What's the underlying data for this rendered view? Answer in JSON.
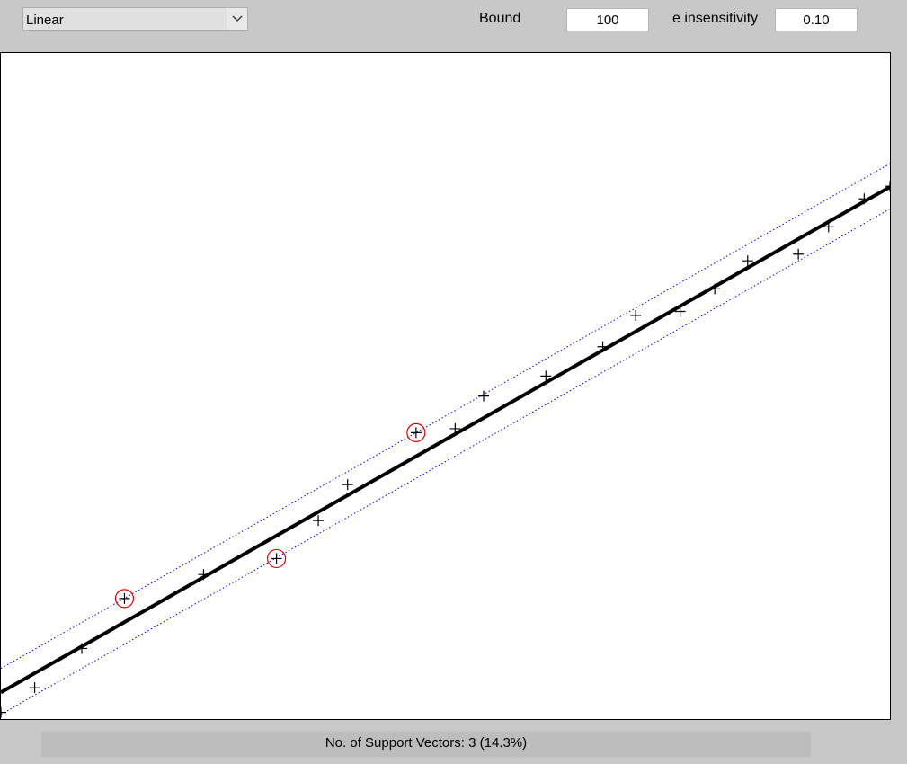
{
  "kernel": {
    "selected": "Linear"
  },
  "params": {
    "bound_label": "Bound",
    "bound_value": "100",
    "epsilon_label": "e insensitivity",
    "epsilon_value": "0.10"
  },
  "status": {
    "text": "No. of Support Vectors: 3 (14.3%)"
  },
  "colors": {
    "background": "#c8c8c8",
    "regression_line": "#000000",
    "tube_line": "#0000ff",
    "support_vector_ring": "#e00000"
  },
  "chart_data": {
    "type": "scatter",
    "xlim": [
      0,
      1
    ],
    "ylim": [
      0,
      1
    ],
    "grid": false,
    "points": [
      {
        "x": 0.0,
        "y": 0.01,
        "sv": false
      },
      {
        "x": 0.038,
        "y": 0.047,
        "sv": false
      },
      {
        "x": 0.091,
        "y": 0.106,
        "sv": false
      },
      {
        "x": 0.139,
        "y": 0.181,
        "sv": true
      },
      {
        "x": 0.228,
        "y": 0.217,
        "sv": false
      },
      {
        "x": 0.31,
        "y": 0.241,
        "sv": true
      },
      {
        "x": 0.357,
        "y": 0.298,
        "sv": false
      },
      {
        "x": 0.39,
        "y": 0.352,
        "sv": false
      },
      {
        "x": 0.467,
        "y": 0.43,
        "sv": true
      },
      {
        "x": 0.511,
        "y": 0.436,
        "sv": false
      },
      {
        "x": 0.543,
        "y": 0.485,
        "sv": false
      },
      {
        "x": 0.613,
        "y": 0.515,
        "sv": false
      },
      {
        "x": 0.677,
        "y": 0.559,
        "sv": false
      },
      {
        "x": 0.714,
        "y": 0.606,
        "sv": false
      },
      {
        "x": 0.764,
        "y": 0.612,
        "sv": false
      },
      {
        "x": 0.803,
        "y": 0.646,
        "sv": false
      },
      {
        "x": 0.84,
        "y": 0.688,
        "sv": false
      },
      {
        "x": 0.897,
        "y": 0.698,
        "sv": false
      },
      {
        "x": 0.931,
        "y": 0.739,
        "sv": false
      },
      {
        "x": 0.971,
        "y": 0.781,
        "sv": false
      },
      {
        "x": 1.0,
        "y": 0.8,
        "sv": false
      }
    ],
    "regression": {
      "x": [
        0,
        1
      ],
      "y": [
        0.04,
        0.799
      ]
    },
    "tube_upper": {
      "x": [
        0,
        1
      ],
      "y": [
        0.076,
        0.834
      ]
    },
    "tube_lower": {
      "x": [
        0,
        1
      ],
      "y": [
        0.007,
        0.766
      ]
    }
  }
}
